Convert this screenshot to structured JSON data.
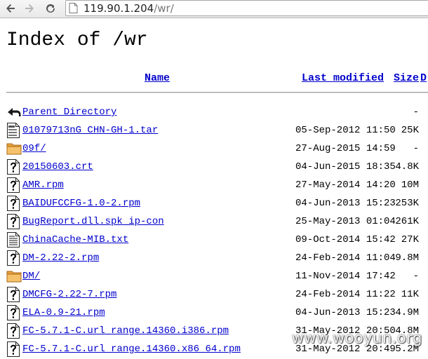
{
  "browser": {
    "url_host": "119.90.1.204",
    "url_path": "/wr/",
    "icons": {
      "back": "back-arrow-icon",
      "forward": "forward-arrow-icon",
      "reload": "reload-icon",
      "page": "page-icon"
    }
  },
  "page": {
    "title": "Index of /wr",
    "columns": {
      "name": "Name",
      "last_modified": "Last modified",
      "size": "Size",
      "description": "D"
    },
    "entries": [
      {
        "icon": "back-icon",
        "name": "Parent Directory",
        "modified": "",
        "size": "-"
      },
      {
        "icon": "compressed-file-icon",
        "name": "01079713nG_CHN-GH-1.tar",
        "modified": "05-Sep-2012 11:50",
        "size": "25K"
      },
      {
        "icon": "folder-icon",
        "name": "09f/",
        "modified": "27-Aug-2015 14:59",
        "size": "-"
      },
      {
        "icon": "unknown-file-icon",
        "name": "20150603.crt",
        "modified": "04-Jun-2015 18:35",
        "size": "4.8K"
      },
      {
        "icon": "unknown-file-icon",
        "name": "AMR.rpm",
        "modified": "27-May-2014 14:20",
        "size": "10M"
      },
      {
        "icon": "unknown-file-icon",
        "name": "BAIDUFCCFG-1.0-2.rpm",
        "modified": "04-Jun-2013 15:23",
        "size": "253K"
      },
      {
        "icon": "unknown-file-icon",
        "name": "BugReport.dll.spk_ip-con",
        "modified": "25-May-2013 01:04",
        "size": "261K"
      },
      {
        "icon": "text-file-icon",
        "name": "ChinaCache-MIB.txt",
        "modified": "09-Oct-2014 15:42",
        "size": "27K"
      },
      {
        "icon": "unknown-file-icon",
        "name": "DM-2.22-2.rpm",
        "modified": "24-Feb-2014 11:04",
        "size": "9.8M"
      },
      {
        "icon": "folder-icon",
        "name": "DM/",
        "modified": "11-Nov-2014 17:42",
        "size": "-"
      },
      {
        "icon": "unknown-file-icon",
        "name": "DMCFG-2.22-7.rpm",
        "modified": "24-Feb-2014 11:22",
        "size": "11K"
      },
      {
        "icon": "unknown-file-icon",
        "name": "ELA-0.9-21.rpm",
        "modified": "04-Jun-2013 15:23",
        "size": "4.9M"
      },
      {
        "icon": "unknown-file-icon",
        "name": "FC-5.7.1-C.url_range.14360.i386.rpm",
        "modified": "31-May-2012 20:50",
        "size": "4.8M"
      },
      {
        "icon": "unknown-file-icon",
        "name": "FC-5.7.1-C.url_range.14360.x86_64.rpm",
        "modified": "31-May-2012 20:49",
        "size": "5.2M"
      }
    ]
  },
  "watermark": "www.wooyun.org"
}
